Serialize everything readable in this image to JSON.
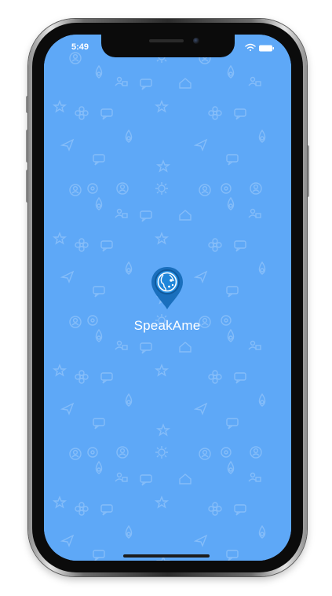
{
  "status_bar": {
    "time": "5:49",
    "icons": [
      "wifi-icon",
      "battery-icon"
    ]
  },
  "splash": {
    "app_name": "SpeakAme",
    "logo_icon": "location-pin-globe-icon"
  },
  "colors": {
    "background": "#5ea8f7",
    "pattern": "#7fbaf9",
    "logo_fill": "#1f7fd0",
    "logo_dark": "#135ea6",
    "text": "#ffffff"
  }
}
